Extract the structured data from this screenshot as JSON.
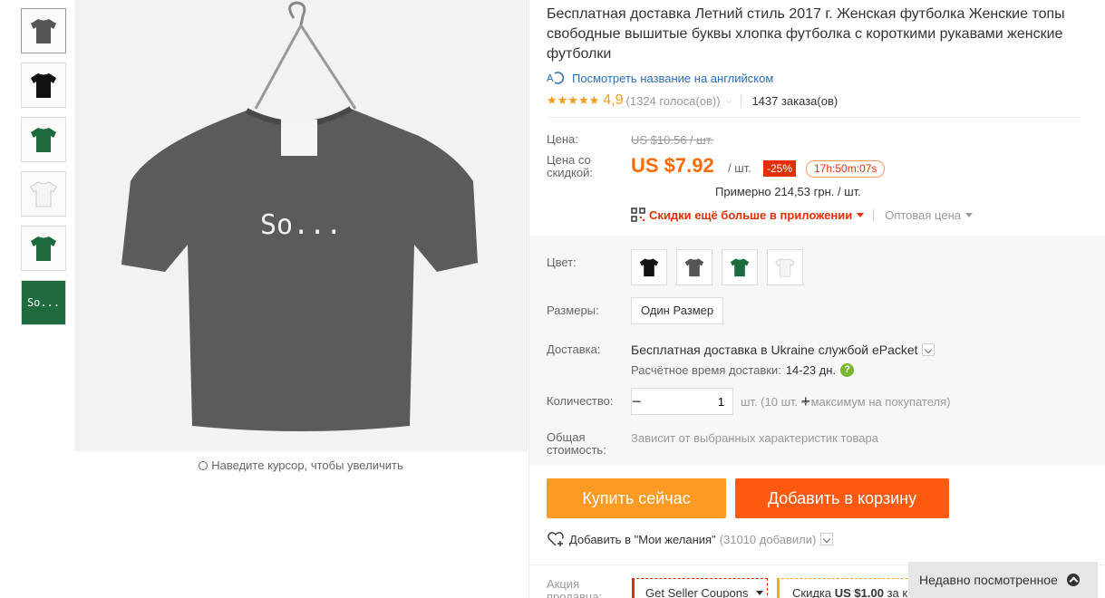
{
  "thumbnails": [
    "gray-tshirt",
    "black-tshirt",
    "green-tshirt",
    "white-tshirt",
    "green-tshirt-2",
    "so-text-closeup"
  ],
  "thumb_text": "So...",
  "main_image": {
    "print_text": "So..."
  },
  "zoom_hint": "Наведите курсор, чтобы увеличить",
  "product": {
    "title": "Бесплатная доставка Летний стиль 2017 г. Женская футболка Женские топы свободные вышитые буквы хлопка футболка с короткими рукавами женские футболки",
    "translate_link": "Посмотреть название на английском",
    "stars": "★★★★★",
    "rating": "4,9",
    "votes": "(1324 голоса(ов))",
    "orders": "1437 заказа(ов)"
  },
  "price": {
    "label": "Цена:",
    "old": "US $10.56 / шт.",
    "discount_label": "Цена со скидкой:",
    "new": "US $7.92",
    "per_unit": "/ шт.",
    "discount_badge": "-25%",
    "timer": "17h:50m:07s",
    "approx": "Примерно 214,53 грн. / шт.",
    "app_link": "Скидки ещё больше в приложении",
    "wholesale": "Оптовая цена"
  },
  "options": {
    "color_label": "Цвет:",
    "colors": [
      "black",
      "gray",
      "green",
      "white"
    ],
    "size_label": "Размеры:",
    "size_value": "Один Размер",
    "shipping_label": "Доставка:",
    "shipping_text": "Бесплатная доставка в Ukraine службой ePacket",
    "delivery_time_label": "Расчётное время доставки:",
    "delivery_days": "14-23 дн.",
    "qty_label": "Количество:",
    "qty_value": "1",
    "qty_note": "шт. (10 шт. – максимум на покупателя)",
    "total_label": "Общая стоимость:",
    "total_note": "Зависит от выбранных характеристик товара"
  },
  "actions": {
    "buy_now": "Купить сейчас",
    "add_to_cart": "Добавить в корзину",
    "wishlist": "Добавить в \"Мои желания\"",
    "wishlist_count": "(31010 добавили)"
  },
  "promo": {
    "label": "Акция продавца:",
    "coupon": "Get Seller Coupons",
    "discount_prefix": "Скидка",
    "discount_amount": "US $1.00",
    "discount_suffix": "за к"
  },
  "recently_viewed": "Недавно посмотренное",
  "colors": {
    "accent": "#ff6a00",
    "buy": "#ff9b25",
    "cart": "#ff5a0f",
    "link": "#2a6ebb",
    "red": "#e62e04",
    "star": "#f49b19"
  }
}
